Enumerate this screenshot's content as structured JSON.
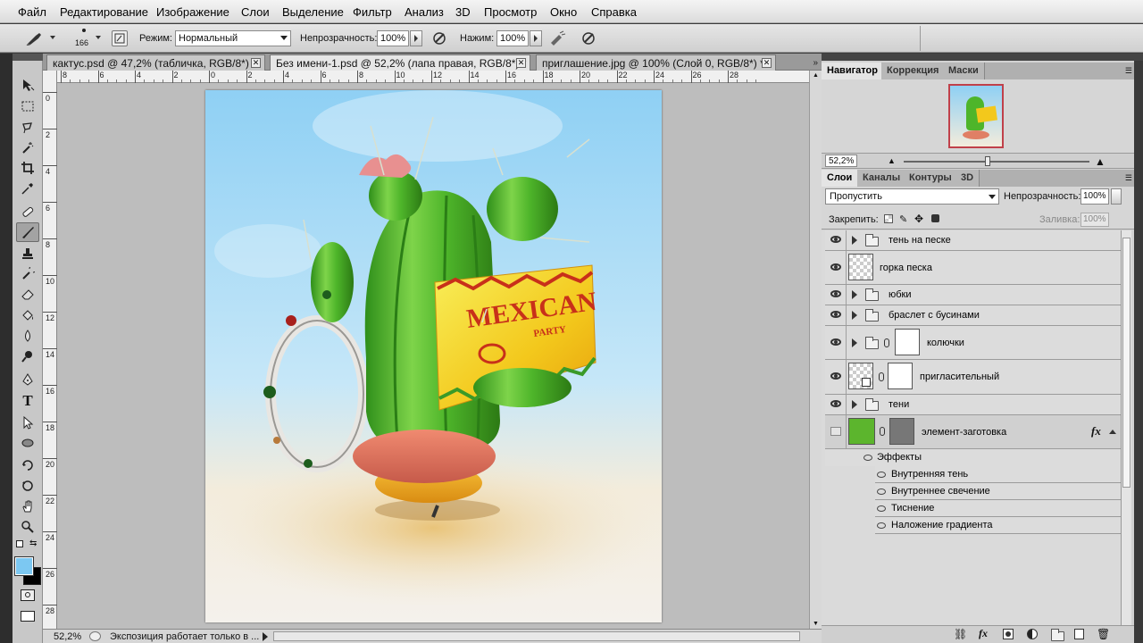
{
  "menu": [
    "Файл",
    "Редактирование",
    "Изображение",
    "Слои",
    "Выделение",
    "Фильтр",
    "Анализ",
    "3D",
    "Просмотр",
    "Окно",
    "Справка"
  ],
  "options": {
    "brush_size": "166",
    "mode_label": "Режим:",
    "mode_value": "Нормальный",
    "opacity_label": "Непрозрачность:",
    "opacity_value": "100%",
    "pressure_label": "Нажим:",
    "pressure_value": "100%"
  },
  "tabs": [
    {
      "label": "кактус.psd @ 47,2% (табличка, RGB/8*) *",
      "active": false
    },
    {
      "label": "Без имени-1.psd @ 52,2% (лапа правая, RGB/8*) *",
      "active": true
    },
    {
      "label": "приглашение.jpg @ 100% (Слой 0, RGB/8*) *",
      "active": false
    }
  ],
  "ruler_top": [
    "8",
    "6",
    "4",
    "2",
    "0",
    "2",
    "4",
    "6",
    "8",
    "10",
    "12",
    "14",
    "16",
    "18",
    "20",
    "22",
    "24",
    "26",
    "28"
  ],
  "ruler_left": [
    "0",
    "2",
    "4",
    "6",
    "8",
    "10",
    "12",
    "14",
    "16",
    "18",
    "20",
    "22",
    "24",
    "26",
    "28"
  ],
  "artwork": {
    "sign_title": "MEXICAN",
    "sign_sub": "PARTY"
  },
  "status": {
    "zoom": "52,2%",
    "message": "Экспозиция работает только в ..."
  },
  "navigator": {
    "tabs": [
      "Навигатор",
      "Коррекция",
      "Маски"
    ],
    "zoom": "52,2%"
  },
  "layers_panel": {
    "tabs": [
      "Слои",
      "Каналы",
      "Контуры",
      "3D"
    ],
    "blend_mode": "Пропустить",
    "opacity_label": "Непрозрачность:",
    "opacity_value": "100%",
    "lock_label": "Закрепить:",
    "fill_label": "Заливка:",
    "fill_value": "100%",
    "layers": [
      {
        "name": "тень на песке",
        "type": "group"
      },
      {
        "name": "горка песка",
        "type": "layer"
      },
      {
        "name": "юбки",
        "type": "group"
      },
      {
        "name": "браслет с бусинами",
        "type": "group"
      },
      {
        "name": "колючки",
        "type": "group-mask"
      },
      {
        "name": "пригласительный",
        "type": "smart-mask"
      },
      {
        "name": "тени",
        "type": "group"
      },
      {
        "name": "элемент-заготовка",
        "type": "fill-mask"
      }
    ],
    "effects_label": "Эффекты",
    "effects": [
      "Внутренняя тень",
      "Внутреннее свечение",
      "Тиснение",
      "Наложение градиента"
    ]
  },
  "colors": {
    "foreground": "#7cc8f2",
    "background": "#000000",
    "accent_green": "#5cb52d",
    "nav_frame": "#c0404a"
  }
}
